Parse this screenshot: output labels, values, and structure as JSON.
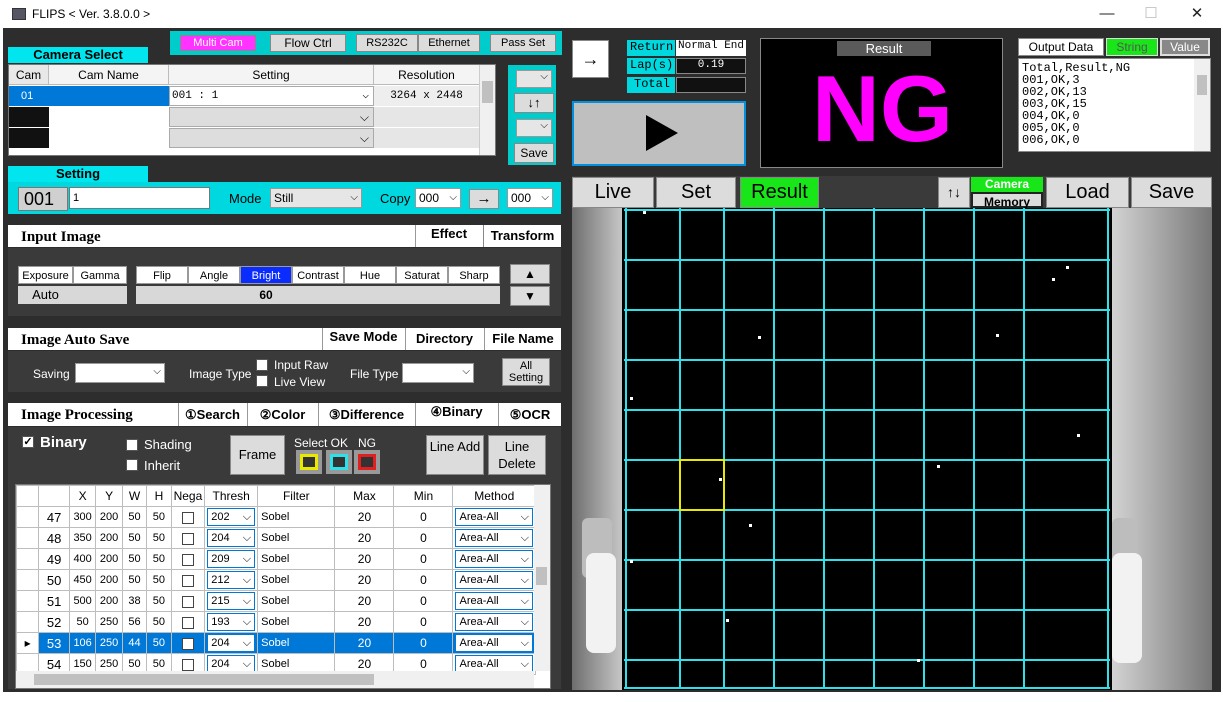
{
  "window": {
    "title": "FLIPS  < Ver. 3.8.0.0 >",
    "min": "—",
    "max": "☐",
    "close": "✕"
  },
  "toolbar": {
    "multi_cam": "Multi Cam",
    "flow_ctrl": "Flow Ctrl",
    "rs232c": "RS232C",
    "ethernet": "Ethernet",
    "pass_set": "Pass Set"
  },
  "camera_select": {
    "title": "Camera Select",
    "headers": [
      "Cam",
      "Cam Name",
      "Setting",
      "Resolution"
    ],
    "rows": [
      {
        "cam": "01",
        "name": "",
        "setting": "001 : 1",
        "resolution": "3264 x 2448"
      },
      {
        "cam": "",
        "name": "",
        "setting": "",
        "resolution": ""
      },
      {
        "cam": "",
        "name": "",
        "setting": "",
        "resolution": ""
      }
    ],
    "updown": "↓↑",
    "save": "Save"
  },
  "setting": {
    "title": "Setting",
    "number": "001",
    "name": "1",
    "mode_label": "Mode",
    "mode_value": "Still",
    "copy_label": "Copy",
    "copy_from": "000",
    "copy_arrow": "→",
    "copy_to": "000"
  },
  "input_image": {
    "title": "Input Image",
    "tabs": [
      "Effect",
      "Transform"
    ],
    "labels": [
      "Exposure",
      "Gamma",
      "Flip",
      "Angle",
      "Bright",
      "Contrast",
      "Hue",
      "Saturat",
      "Sharp"
    ],
    "exposure_value": "Auto",
    "bright_value": "60",
    "up": "▲",
    "down": "▼"
  },
  "auto_save": {
    "title": "Image Auto Save",
    "tabs": [
      "Save Mode",
      "Directory",
      "File Name"
    ],
    "saving_label": "Saving",
    "image_type_label": "Image Type",
    "input_raw": "Input Raw",
    "live_view": "Live View",
    "file_type_label": "File Type",
    "all_setting": "All Setting"
  },
  "image_processing": {
    "title": "Image Processing",
    "tabs": [
      "①Search",
      "②Color",
      "③Difference",
      "④Binary",
      "⑤OCR"
    ],
    "binary_label": "Binary",
    "shading": "Shading",
    "inherit": "Inherit",
    "frame": "Frame",
    "select_ok": "Select OK",
    "ng": "NG",
    "line_add": "Line Add",
    "line_delete": "Line Delete",
    "table_headers": [
      "",
      "X",
      "Y",
      "W",
      "H",
      "Nega",
      "Thresh",
      "Filter",
      "Max",
      "Min",
      "Method"
    ],
    "rows": [
      {
        "id": "47",
        "x": "300",
        "y": "200",
        "w": "50",
        "h": "50",
        "thresh": "202",
        "filter": "Sobel",
        "max": "20",
        "min": "0",
        "method": "Area-All"
      },
      {
        "id": "48",
        "x": "350",
        "y": "200",
        "w": "50",
        "h": "50",
        "thresh": "204",
        "filter": "Sobel",
        "max": "20",
        "min": "0",
        "method": "Area-All"
      },
      {
        "id": "49",
        "x": "400",
        "y": "200",
        "w": "50",
        "h": "50",
        "thresh": "209",
        "filter": "Sobel",
        "max": "20",
        "min": "0",
        "method": "Area-All"
      },
      {
        "id": "50",
        "x": "450",
        "y": "200",
        "w": "50",
        "h": "50",
        "thresh": "212",
        "filter": "Sobel",
        "max": "20",
        "min": "0",
        "method": "Area-All"
      },
      {
        "id": "51",
        "x": "500",
        "y": "200",
        "w": "38",
        "h": "50",
        "thresh": "215",
        "filter": "Sobel",
        "max": "20",
        "min": "0",
        "method": "Area-All"
      },
      {
        "id": "52",
        "x": "50",
        "y": "250",
        "w": "56",
        "h": "50",
        "thresh": "193",
        "filter": "Sobel",
        "max": "20",
        "min": "0",
        "method": "Area-All"
      },
      {
        "id": "53",
        "x": "106",
        "y": "250",
        "w": "44",
        "h": "50",
        "thresh": "204",
        "filter": "Sobel",
        "max": "20",
        "min": "0",
        "method": "Area-All",
        "selected": true
      },
      {
        "id": "54",
        "x": "150",
        "y": "250",
        "w": "50",
        "h": "50",
        "thresh": "204",
        "filter": "Sobel",
        "max": "20",
        "min": "0",
        "method": "Area-All"
      }
    ]
  },
  "status": {
    "return_label": "Return",
    "return_value": "Normal End",
    "lap_label": "Lap(s)",
    "lap_value": "0.19",
    "total_label": "Total",
    "total_value": ""
  },
  "result": {
    "title": "Result",
    "value": "NG",
    "color": "#ff00ff"
  },
  "output": {
    "title": "Output Data",
    "string": "String",
    "value": "Value",
    "lines": [
      "Total,Result,NG",
      "001,OK,3",
      "002,OK,13",
      "003,OK,15",
      "004,OK,0",
      "005,OK,0",
      "006,OK,0"
    ]
  },
  "view": {
    "live": "Live",
    "set": "Set",
    "result": "Result",
    "arrows": "↑↓",
    "camera": "Camera",
    "memory": "Memory",
    "load": "Load",
    "save": "Save"
  },
  "colors": {
    "accent_cyan": "#00e5ee",
    "result_green": "#19e619",
    "magenta": "#ff00ff",
    "select_blue": "#0078d7",
    "grid_line": "#2fe0e8",
    "frame_yellow": "#e8e800"
  },
  "icons": {
    "arrow": "arrow-right-icon",
    "play": "play-icon"
  }
}
